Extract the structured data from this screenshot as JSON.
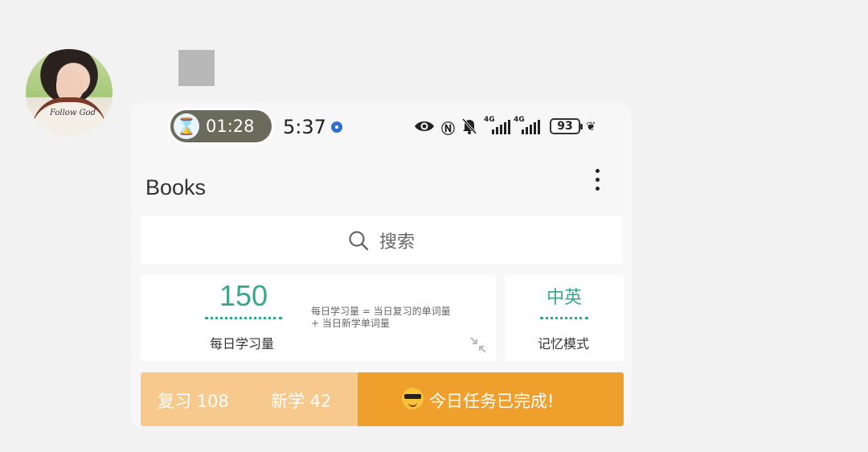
{
  "status_bar": {
    "timer": "01:28",
    "clock": "5:37",
    "signal1": "4G",
    "signal2": "4G",
    "battery": "93"
  },
  "app": {
    "title": "Books",
    "search_placeholder": "搜索",
    "daily_amount": "150",
    "daily_amount_label": "每日学习量",
    "formula": "每日学习量 = 当日复习的单词量 + 当日新学单词量",
    "mode_value": "中英",
    "mode_label": "记忆模式",
    "review": "复习 108",
    "new_learn": "新学 42",
    "done": "今日任务已完成!"
  },
  "colors": {
    "accent": "#3aa58c",
    "progress_light": "#f7c98d",
    "progress_dark": "#ef9f2b"
  }
}
